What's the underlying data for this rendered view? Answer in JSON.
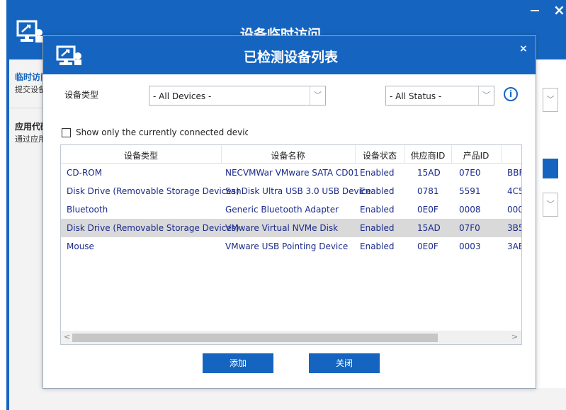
{
  "back_window": {
    "title": "设备临时访问",
    "nav": [
      {
        "label": "临时访问",
        "sub": "提交设备"
      },
      {
        "label": "应用代码",
        "sub": "通过应用"
      }
    ],
    "close_glyph": "×",
    "dropdown_arrow": "﹀"
  },
  "dialog": {
    "title": "已检测设备列表",
    "close_glyph": "×",
    "device_type_label": "设备类型",
    "device_type_value": "- All Devices -",
    "status_value": "- All Status -",
    "dropdown_arrow": "﹀",
    "info_glyph": "i",
    "checkbox_label": "Show only the currently connected devices",
    "columns": [
      "设备类型",
      "设备名称",
      "设备状态",
      "供应商ID",
      "产品ID"
    ],
    "rows": [
      {
        "type": "CD-ROM",
        "name": "NECVMWar VMware SATA CD01",
        "status": "Enabled",
        "vendor": "15AD",
        "product": "07E0",
        "extra": "BBF"
      },
      {
        "type": "Disk Drive (Removable Storage Devices)",
        "name": "SanDisk Ultra USB 3.0 USB Device",
        "status": "Enabled",
        "vendor": "0781",
        "product": "5591",
        "extra": "4C5"
      },
      {
        "type": "Bluetooth",
        "name": "Generic Bluetooth Adapter",
        "status": "Enabled",
        "vendor": "0E0F",
        "product": "0008",
        "extra": "000"
      },
      {
        "type": "Disk Drive (Removable Storage Devices)",
        "name": "VMware Virtual NVMe Disk",
        "status": "Enabled",
        "vendor": "15AD",
        "product": "07F0",
        "extra": "3B5",
        "selected": true
      },
      {
        "type": "Mouse",
        "name": "VMware USB Pointing Device",
        "status": "Enabled",
        "vendor": "0E0F",
        "product": "0003",
        "extra": "3AE"
      }
    ],
    "scroll_left": "<",
    "scroll_right": ">",
    "add_button": "添加",
    "close_button": "关闭"
  },
  "colors": {
    "brand_blue": "#1565c0",
    "row_selected": "#d9d9d9",
    "cell_text": "#1a2a8a"
  }
}
